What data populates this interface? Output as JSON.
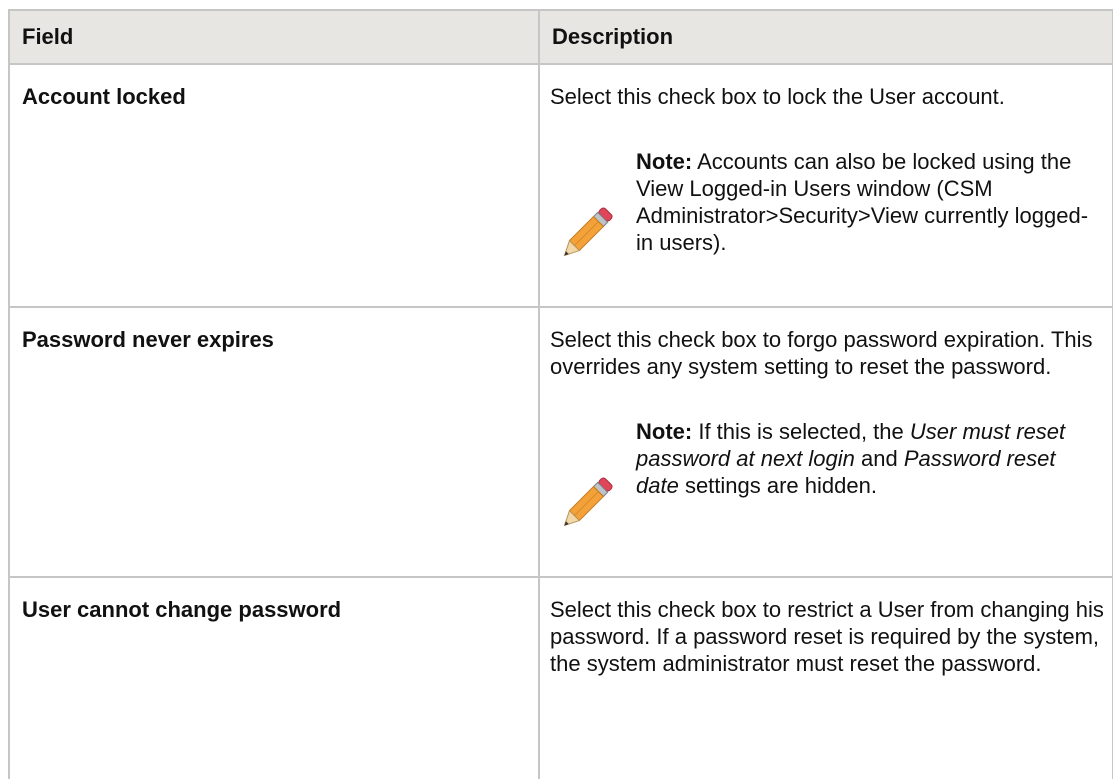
{
  "table": {
    "headers": {
      "field": "Field",
      "description": "Description"
    },
    "rows": [
      {
        "field": "Account locked",
        "description": "Select this check box to lock the User account.",
        "note": {
          "label": "Note:",
          "text": " Accounts can also be locked using the View Logged-in Users window (CSM Administrator>Security>View currently logged-in users)."
        }
      },
      {
        "field": "Password never expires",
        "description": "Select this check box to forgo password expiration. This overrides any system setting to reset the password.",
        "note": {
          "label": "Note:",
          "text_a": " If this is selected, the ",
          "italic_a": "User must reset password at next login",
          "text_b": " and ",
          "italic_b": "Password reset date",
          "text_c": " settings are hidden."
        }
      },
      {
        "field": "User cannot change password",
        "description": "Select this check box to restrict a User from changing his password. If a password reset is required by the system, the system administrator must reset the password."
      }
    ]
  },
  "icons": {
    "note": "pencil-icon"
  }
}
